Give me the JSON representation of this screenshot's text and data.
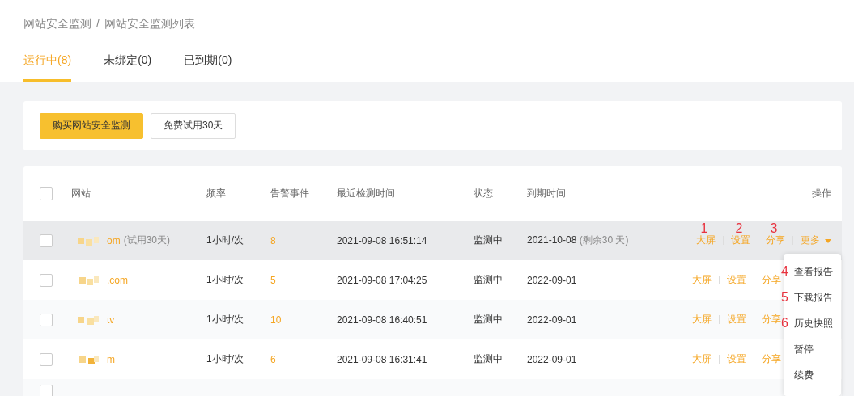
{
  "breadcrumb": [
    "网站安全监测",
    "/",
    "网站安全监测列表"
  ],
  "tabs": [
    {
      "label": "运行中(8)",
      "selected": true
    },
    {
      "label": "未绑定(0)",
      "selected": false
    },
    {
      "label": "已到期(0)",
      "selected": false
    }
  ],
  "toolbar": {
    "buttons": [
      {
        "label": "购买网站安全监测",
        "kind": "primary"
      },
      {
        "label": "免费试用30天",
        "kind": "default"
      }
    ]
  },
  "table": {
    "select_all_checked": false,
    "columns": [
      "网站",
      "频率",
      "告警事件",
      "最近检测时间",
      "状态",
      "到期时间",
      "操作"
    ],
    "rows": [
      {
        "site": "om",
        "site_note": "(试用30天)",
        "frequency": "1小时/次",
        "alerts": "8",
        "last_check": "2021-09-08 16:51:14",
        "status": "监测中",
        "expiry": "2021-10-08",
        "expiry_note": "(剩余30 天)",
        "highlighted": true,
        "checked": false,
        "actions": [
          {
            "label": "大屏",
            "annotation": "1"
          },
          {
            "label": "设置",
            "annotation": "2"
          },
          {
            "label": "分享",
            "annotation": "3"
          },
          {
            "label": "更多",
            "kind": "dropdown"
          }
        ]
      },
      {
        "site": ".com",
        "frequency": "1小时/次",
        "alerts": "5",
        "last_check": "2021-09-08 17:04:25",
        "status": "监测中",
        "expiry": "2022-09-01",
        "highlighted": false,
        "checked": false,
        "actions": [
          {
            "label": "大屏"
          },
          {
            "label": "设置"
          },
          {
            "label": "分享"
          }
        ]
      },
      {
        "site": "tv",
        "frequency": "1小时/次",
        "alerts": "10",
        "last_check": "2021-09-08 16:40:51",
        "status": "监测中",
        "expiry": "2022-09-01",
        "highlighted": false,
        "checked": false,
        "actions": [
          {
            "label": "大屏"
          },
          {
            "label": "设置"
          },
          {
            "label": "分享"
          }
        ]
      },
      {
        "site": "m",
        "frequency": "1小时/次",
        "alerts": "6",
        "last_check": "2021-09-08 16:31:41",
        "status": "监测中",
        "expiry": "2022-09-01",
        "highlighted": false,
        "checked": false,
        "actions": [
          {
            "label": "大屏"
          },
          {
            "label": "设置"
          },
          {
            "label": "分享"
          }
        ]
      }
    ],
    "partial_row": {
      "checked": false
    }
  },
  "dropdown_menu": [
    {
      "label": "查看报告",
      "annotation": "4"
    },
    {
      "label": "下载报告",
      "annotation": "5"
    },
    {
      "label": "历史快照",
      "annotation": "6"
    },
    {
      "label": "暂停"
    },
    {
      "label": "续费"
    }
  ]
}
